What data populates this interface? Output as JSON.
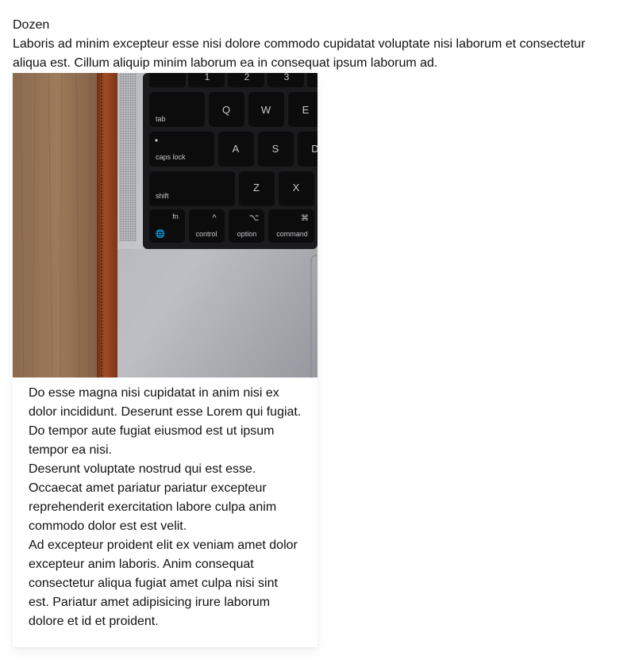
{
  "page": {
    "heading": "Dozen",
    "intro": "Laboris ad minim excepteur esse nisi dolore commodo cupidatat voluptate nisi laborum et consectetur aliqua est. Cillum aliquip minim laborum ea in consequat ipsum laborum ad."
  },
  "card": {
    "image": {
      "description_icon": "laptop-keyboard-photo",
      "keys": {
        "n1": "1",
        "n2": "2",
        "n3": "3",
        "tab": "tab",
        "q": "Q",
        "w": "W",
        "e": "E",
        "caps": "caps lock",
        "a": "A",
        "s": "S",
        "d": "D",
        "shift": "shift",
        "z": "Z",
        "x": "X",
        "fn": "fn",
        "control": "control",
        "option": "option",
        "command": "command",
        "ctrl_symbol": "^",
        "opt_symbol": "⌥",
        "cmd_symbol": "⌘",
        "globe_symbol": "🌐"
      }
    },
    "paragraphs": [
      "Do esse magna nisi cupidatat in anim nisi ex dolor incididunt. Deserunt esse Lorem qui fugiat. Do tempor aute fugiat eiusmod est ut ipsum tempor ea nisi.",
      "Deserunt voluptate nostrud qui est esse. Occaecat amet pariatur pariatur excepteur reprehenderit exercitation labore culpa anim commodo dolor est est velit.",
      "Ad excepteur proident elit ex veniam amet dolor excepteur anim laboris. Anim consequat consectetur aliqua fugiat amet culpa nisi sint est. Pariatur amet adipisicing irure laborum dolore et id et proident."
    ]
  }
}
